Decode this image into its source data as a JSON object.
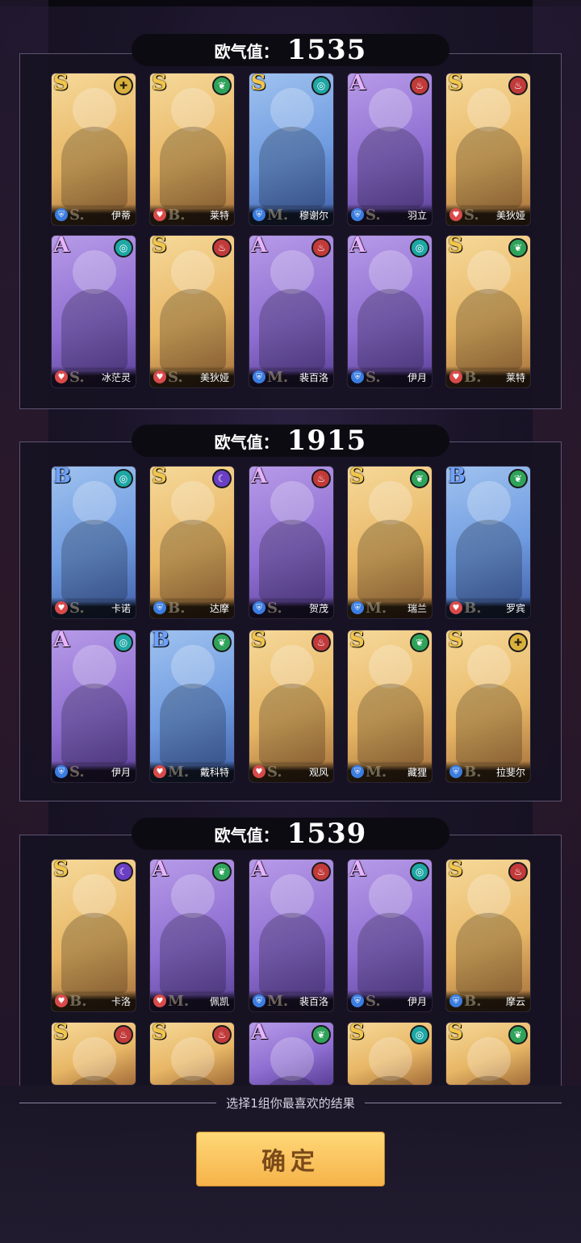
{
  "groups": [
    {
      "label": "欧气值：",
      "score": "1535",
      "cards": [
        {
          "rank": "S",
          "element": "gold",
          "cls": "blue",
          "tier": "S.",
          "name": "伊蒂",
          "bg": "gold"
        },
        {
          "rank": "S",
          "element": "green",
          "cls": "red",
          "tier": "B.",
          "name": "莱特",
          "bg": "gold"
        },
        {
          "rank": "S",
          "element": "teal",
          "cls": "blue",
          "tier": "M.",
          "name": "穆谢尔",
          "bg": "blue"
        },
        {
          "rank": "A",
          "element": "red",
          "cls": "blue",
          "tier": "S.",
          "name": "羽立",
          "bg": "purple"
        },
        {
          "rank": "S",
          "element": "red",
          "cls": "red",
          "tier": "S.",
          "name": "美狄娅",
          "bg": "gold"
        },
        {
          "rank": "A",
          "element": "teal",
          "cls": "red",
          "tier": "S.",
          "name": "冰茫灵",
          "bg": "purple"
        },
        {
          "rank": "S",
          "element": "red",
          "cls": "red",
          "tier": "S.",
          "name": "美狄娅",
          "bg": "gold"
        },
        {
          "rank": "A",
          "element": "red",
          "cls": "blue",
          "tier": "M.",
          "name": "裴百洛",
          "bg": "purple"
        },
        {
          "rank": "A",
          "element": "teal",
          "cls": "blue",
          "tier": "S.",
          "name": "伊月",
          "bg": "purple"
        },
        {
          "rank": "S",
          "element": "green",
          "cls": "red",
          "tier": "B.",
          "name": "莱特",
          "bg": "gold"
        }
      ]
    },
    {
      "label": "欧气值：",
      "score": "1915",
      "cards": [
        {
          "rank": "B",
          "element": "teal",
          "cls": "red",
          "tier": "S.",
          "name": "卡诺",
          "bg": "blue"
        },
        {
          "rank": "S",
          "element": "purple",
          "cls": "blue",
          "tier": "B.",
          "name": "达摩",
          "bg": "gold"
        },
        {
          "rank": "A",
          "element": "red",
          "cls": "blue",
          "tier": "S.",
          "name": "贺茂",
          "bg": "purple"
        },
        {
          "rank": "S",
          "element": "green",
          "cls": "blue",
          "tier": "M.",
          "name": "瑞兰",
          "bg": "gold"
        },
        {
          "rank": "B",
          "element": "green",
          "cls": "red",
          "tier": "B.",
          "name": "罗宾",
          "bg": "blue"
        },
        {
          "rank": "A",
          "element": "teal",
          "cls": "blue",
          "tier": "S.",
          "name": "伊月",
          "bg": "purple"
        },
        {
          "rank": "B",
          "element": "green",
          "cls": "red",
          "tier": "M.",
          "name": "戴科特",
          "bg": "blue"
        },
        {
          "rank": "S",
          "element": "red",
          "cls": "red",
          "tier": "S.",
          "name": "观风",
          "bg": "gold"
        },
        {
          "rank": "S",
          "element": "green",
          "cls": "blue",
          "tier": "M.",
          "name": "藏狸",
          "bg": "gold"
        },
        {
          "rank": "S",
          "element": "gold",
          "cls": "blue",
          "tier": "B.",
          "name": "拉斐尔",
          "bg": "gold"
        }
      ]
    },
    {
      "label": "欧气值：",
      "score": "1539",
      "cards": [
        {
          "rank": "S",
          "element": "purple",
          "cls": "red",
          "tier": "B.",
          "name": "卡洛",
          "bg": "gold"
        },
        {
          "rank": "A",
          "element": "green",
          "cls": "red",
          "tier": "M.",
          "name": "佩凯",
          "bg": "purple"
        },
        {
          "rank": "A",
          "element": "red",
          "cls": "blue",
          "tier": "M.",
          "name": "裴百洛",
          "bg": "purple"
        },
        {
          "rank": "A",
          "element": "teal",
          "cls": "blue",
          "tier": "S.",
          "name": "伊月",
          "bg": "purple"
        },
        {
          "rank": "S",
          "element": "red",
          "cls": "blue",
          "tier": "B.",
          "name": "摩云",
          "bg": "gold"
        },
        {
          "rank": "S",
          "element": "red",
          "cls": "red",
          "tier": "",
          "name": "",
          "bg": "gold"
        },
        {
          "rank": "S",
          "element": "red",
          "cls": "red",
          "tier": "",
          "name": "",
          "bg": "gold"
        },
        {
          "rank": "A",
          "element": "green",
          "cls": "blue",
          "tier": "",
          "name": "",
          "bg": "purple"
        },
        {
          "rank": "S",
          "element": "teal",
          "cls": "blue",
          "tier": "",
          "name": "",
          "bg": "gold"
        },
        {
          "rank": "S",
          "element": "green",
          "cls": "blue",
          "tier": "",
          "name": "",
          "bg": "gold"
        }
      ]
    }
  ],
  "hint": "选择1组你最喜欢的结果",
  "confirm_label": "确定",
  "icons": {
    "element_gold": "cross-icon",
    "element_green": "leaf-icon",
    "element_teal": "swirl-icon",
    "element_red": "flame-icon",
    "element_purple": "moon-icon"
  }
}
